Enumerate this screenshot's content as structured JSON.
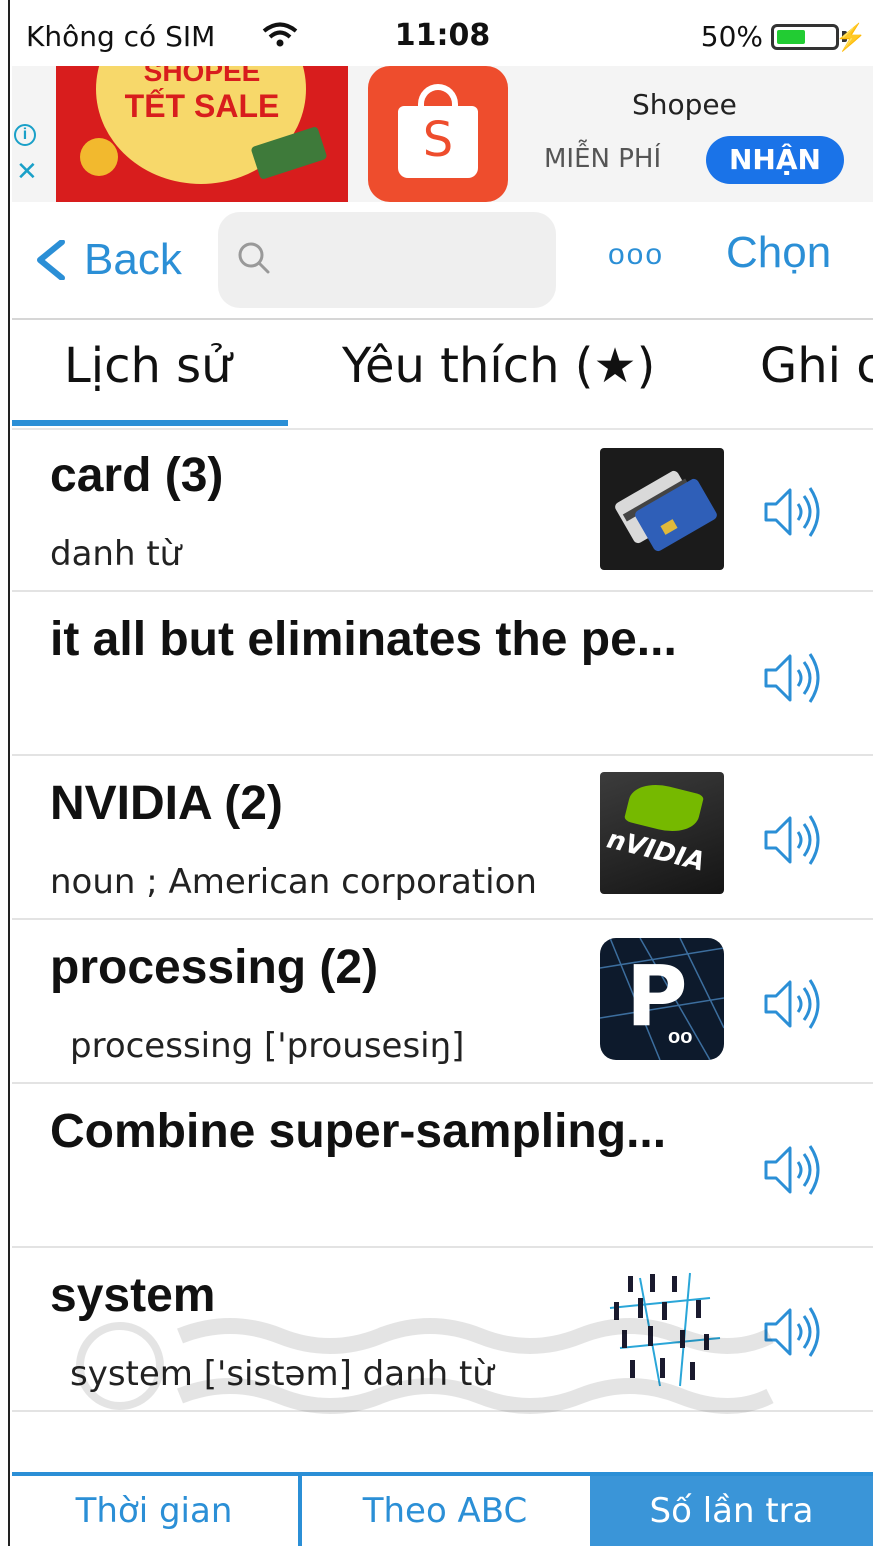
{
  "status_bar": {
    "carrier": "Không có SIM",
    "time": "11:08",
    "battery": "50%"
  },
  "ad": {
    "image_title_line1": "SHOPEE",
    "image_title_line2": "TẾT SALE",
    "app_name": "Shopee",
    "price": "MIỄN PHÍ",
    "get_label": "NHẬN",
    "icons": [
      "info-icon",
      "close-icon"
    ]
  },
  "nav": {
    "back_label": "Back",
    "search_placeholder": "",
    "more_label": "ooo",
    "choose_label": "Chọn"
  },
  "tabs": [
    {
      "label": "Lịch sử",
      "active": true
    },
    {
      "label": "Yêu thích (★)",
      "active": false
    },
    {
      "label": "Ghi c",
      "active": false
    }
  ],
  "items": [
    {
      "title": "card (3)",
      "subtitle": "danh từ",
      "thumbnail": "credit-card-image"
    },
    {
      "title": "it all but eliminates the pe...",
      "subtitle": "",
      "thumbnail": ""
    },
    {
      "title": "NVIDIA (2)",
      "subtitle": "noun ; American corporation",
      "thumbnail": "nvidia-logo-image"
    },
    {
      "title": "processing (2)",
      "subtitle": "processing   ['prousesiŋ]",
      "thumbnail": "processing-logo-image"
    },
    {
      "title": "Combine super-sampling...",
      "subtitle": "",
      "thumbnail": ""
    },
    {
      "title": "system",
      "subtitle": "system   ['sistəm]     danh từ",
      "thumbnail": "people-network-image"
    }
  ],
  "sort_bar": {
    "time_label": "Thời gian",
    "abc_label": "Theo ABC",
    "count_label": "Số lần tra",
    "active": "count"
  },
  "colors": {
    "accent": "#2b8fd6",
    "active_sort_bg": "#3a95d8",
    "shopee": "#ee4d2d",
    "ad_button": "#1a73e8"
  }
}
